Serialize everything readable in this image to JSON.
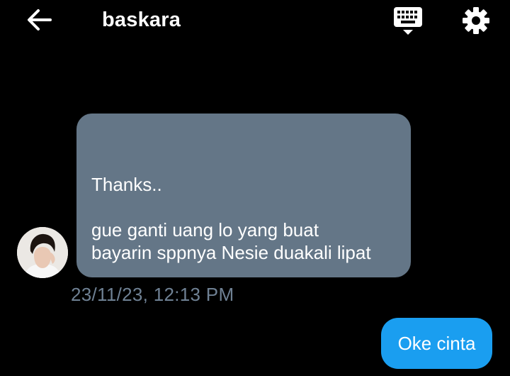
{
  "header": {
    "back_icon": "arrow-left-icon",
    "title": "baskara",
    "keyboard_icon": "keyboard-icon",
    "settings_icon": "gear-icon"
  },
  "messages": [
    {
      "direction": "incoming",
      "lines": [
        "Thanks..",
        "",
        "gue ganti uang lo yang buat",
        "bayarin sppnya Nesie duakali lipat"
      ],
      "timestamp": "23/11/23, 12:13 PM"
    },
    {
      "direction": "outgoing",
      "text": "Oke cinta"
    }
  ],
  "colors": {
    "background": "#000000",
    "incoming_bubble": "#647687",
    "outgoing_bubble": "#1a9ef0",
    "timestamp": "#6f8194"
  }
}
